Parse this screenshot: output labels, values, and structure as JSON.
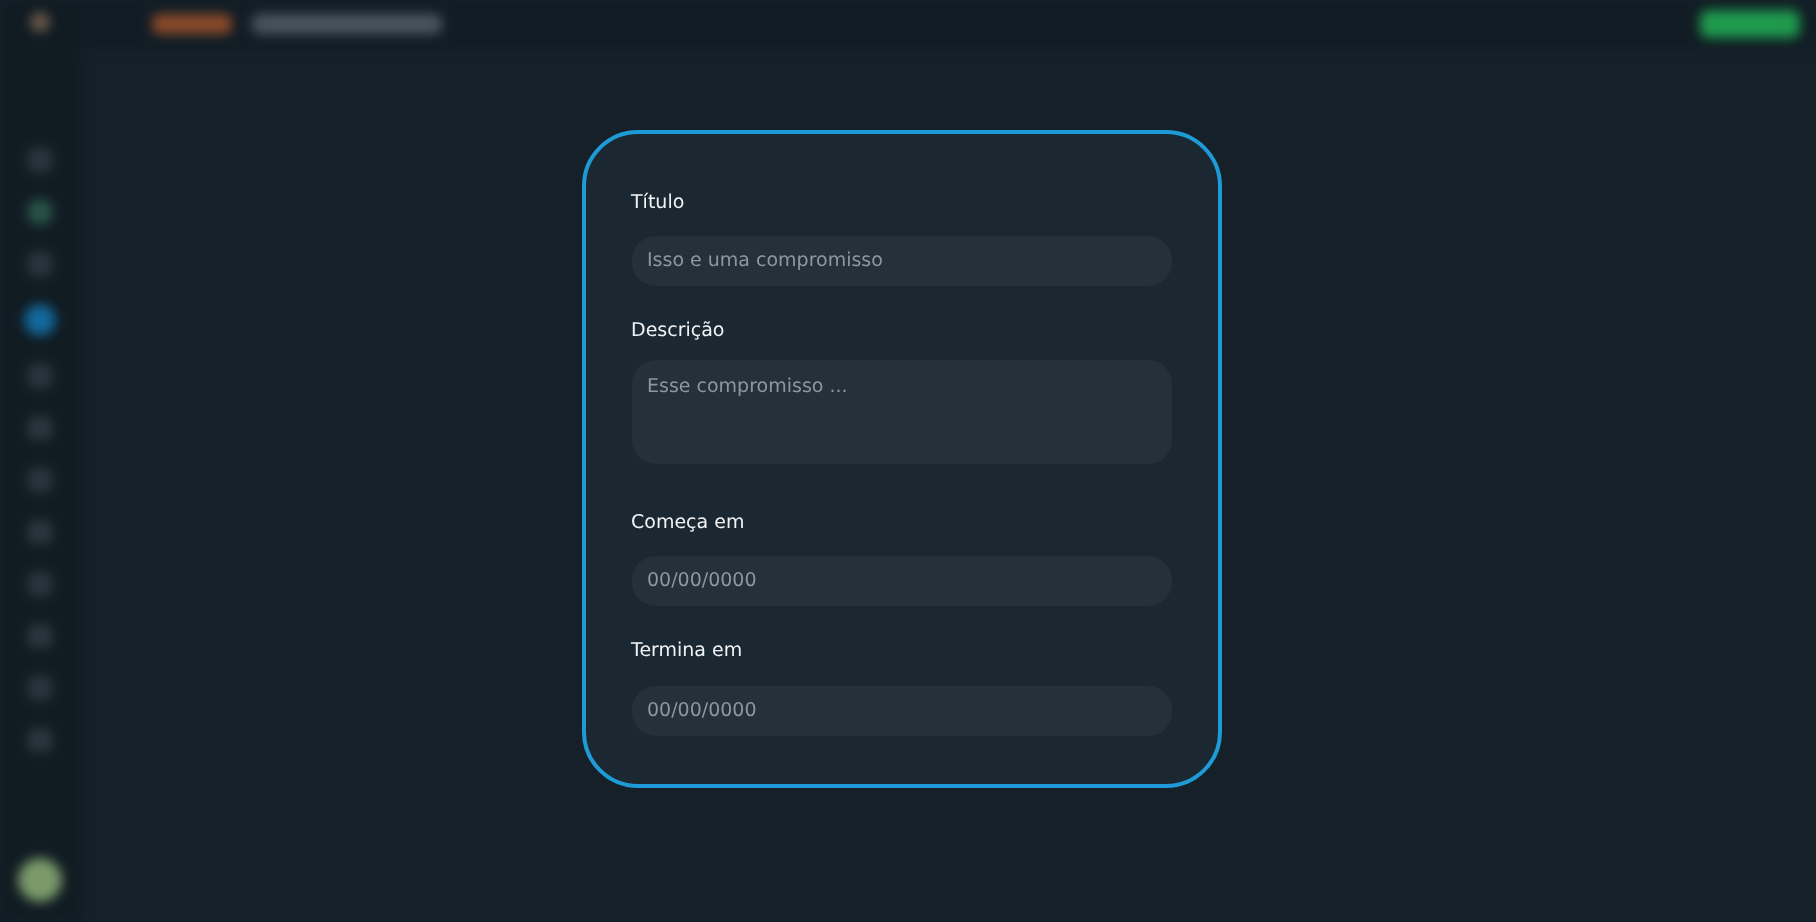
{
  "dialog": {
    "fields": [
      {
        "kind": "input",
        "label": "Título",
        "placeholder": "Isso e uma compromisso"
      },
      {
        "kind": "textarea",
        "label": "Descrição",
        "placeholder": "Esse compromisso ..."
      },
      {
        "kind": "input",
        "label": "Começa em",
        "placeholder": "00/00/0000"
      },
      {
        "kind": "input",
        "label": "Termina em",
        "placeholder": "00/00/0000"
      }
    ]
  }
}
